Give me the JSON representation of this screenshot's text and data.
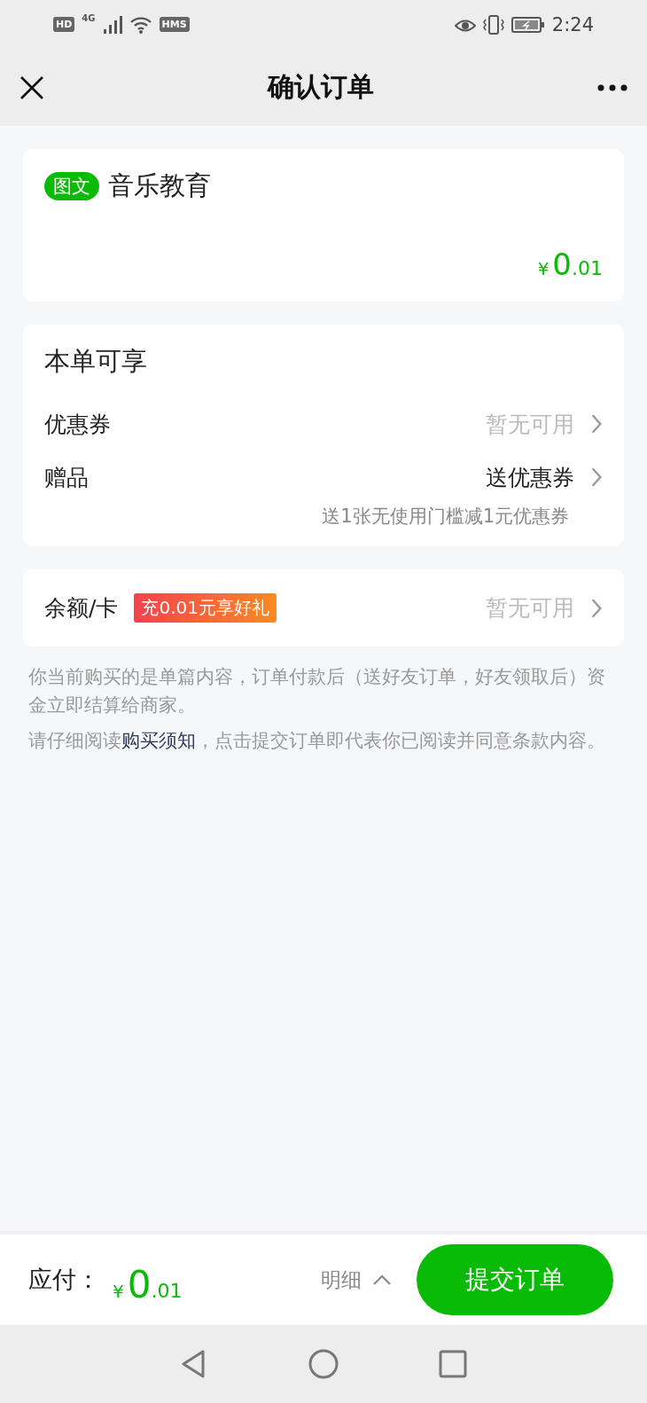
{
  "status_bar": {
    "badges": [
      "HD",
      "HMS"
    ],
    "network": "4G",
    "time": "2:24"
  },
  "nav": {
    "title": "确认订单"
  },
  "product": {
    "tag": "图文",
    "title": "音乐教育",
    "price": {
      "currency": "¥",
      "integer": "0",
      "decimal": ".01"
    }
  },
  "benefits": {
    "title": "本单可享",
    "rows": [
      {
        "label": "优惠券",
        "value": "暂无可用",
        "available": false
      },
      {
        "label": "赠品",
        "value": "送优惠券",
        "available": true,
        "note": "送1张无使用门槛减1元优惠券"
      }
    ]
  },
  "balance": {
    "label": "余额/卡",
    "promo": "充0.01元享好礼",
    "value": "暂无可用",
    "available": false
  },
  "notes": [
    {
      "before": "你当前购买的是单篇内容，订单付款后（送好友订单，好友领取后）资金立即结算给商家。"
    },
    {
      "before": "请仔细阅读",
      "link": "购买须知",
      "after": "，点击提交订单即代表你已阅读并同意条款内容。"
    }
  ],
  "footer": {
    "label": "应付：",
    "price": {
      "currency": "¥",
      "integer": "0",
      "decimal": ".01"
    },
    "details": "明细",
    "submit": "提交订单"
  }
}
